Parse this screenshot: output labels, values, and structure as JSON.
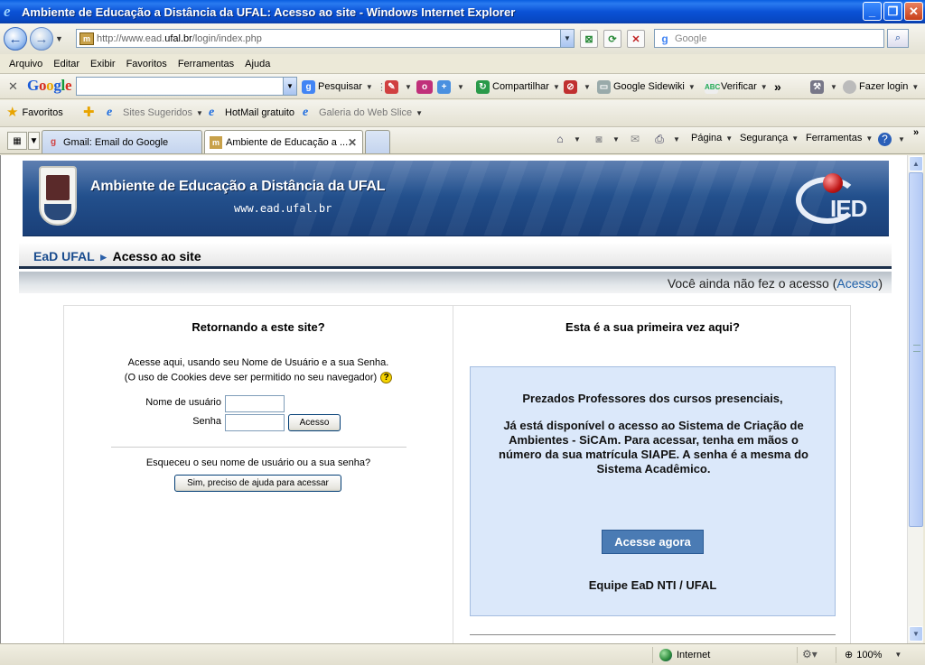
{
  "window": {
    "title": "Ambiente de Educação a Distância da UFAL: Acesso ao site - Windows Internet Explorer",
    "minimize": "_",
    "maximize": "❐",
    "close": "✕"
  },
  "address_bar": {
    "url_prefix": "http://www.ead.",
    "url_domain": "ufal.br",
    "url_path": "/login/index.php"
  },
  "search_box": {
    "placeholder": "Google"
  },
  "menu": [
    "Arquivo",
    "Editar",
    "Exibir",
    "Favoritos",
    "Ferramentas",
    "Ajuda"
  ],
  "google_toolbar": {
    "logo": {
      "g1": "G",
      "o1": "o",
      "o2": "o",
      "g2": "g",
      "l": "l",
      "e": "e"
    },
    "search_label": "Pesquisar",
    "share_label": "Compartilhar",
    "sidewiki_label": "Google Sidewiki",
    "verify_label": "Verificar",
    "more": "»",
    "login_label": "Fazer login"
  },
  "favorites_bar": {
    "favorites_label": "Favoritos",
    "items": [
      "Sites Sugeridos",
      "HotMail gratuito",
      "Galeria do Web Slice"
    ]
  },
  "tabs": [
    {
      "label": "Gmail: Email do Google"
    },
    {
      "label": "Ambiente de Educação a ..."
    }
  ],
  "command_bar": {
    "page_label": "Página",
    "security_label": "Segurança",
    "tools_label": "Ferramentas",
    "more": "»"
  },
  "banner": {
    "title": "Ambiente de Educação a Distância da UFAL",
    "url": "www.ead.ufal.br",
    "logo_text": "IED"
  },
  "breadcrumb": {
    "home": "EaD UFAL",
    "separator": "►",
    "current": "Acesso ao site"
  },
  "login_status": {
    "text": "Você ainda não fez o acesso",
    "link": "Acesso",
    "open": "(",
    "close": ")"
  },
  "returning": {
    "heading": "Retornando a este site?",
    "line1": "Acesse aqui, usando seu Nome de Usuário e a sua Senha.",
    "line2": "(O uso de Cookies deve ser permitido no seu navegador)",
    "help_symbol": "?",
    "username_label": "Nome de usuário",
    "password_label": "Senha",
    "username_value": "",
    "password_value": "",
    "login_button": "Acesso",
    "forgot_text": "Esqueceu o seu nome de usuário ou a sua senha?",
    "forgot_button": "Sim, preciso de ajuda para acessar"
  },
  "first_time": {
    "heading": "Esta é a sua primeira vez aqui?",
    "notice_title": "Prezados Professores dos cursos presenciais,",
    "notice_body": "Já está disponível o acesso ao Sistema de Criação de Ambientes - SiCAm. Para acessar, tenha em mãos o número da sua matrícula SIAPE. A senha é a mesma do Sistema Acadêmico.",
    "access_button": "Acesse agora",
    "signature": "Equipe EaD NTI / UFAL"
  },
  "status_bar": {
    "zone": "Internet",
    "zoom": "100%"
  }
}
